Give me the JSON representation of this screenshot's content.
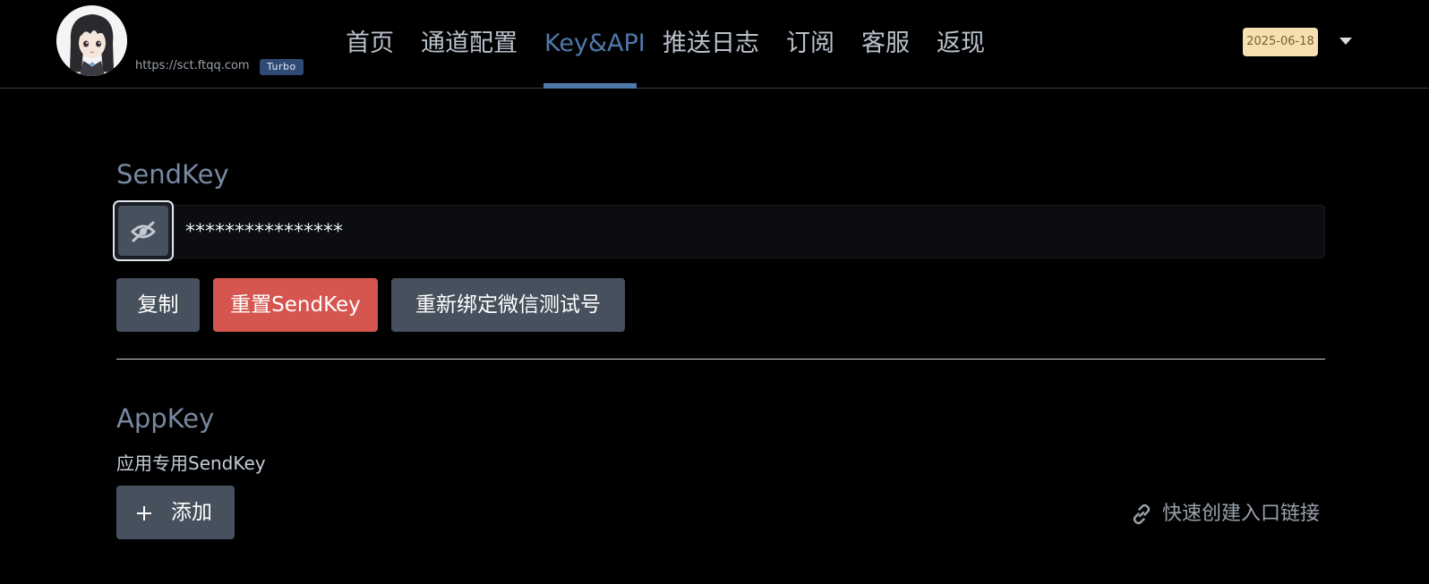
{
  "header": {
    "site_url": "https://sct.ftqq.com",
    "badge": "Turbo",
    "date": "2025-06-18",
    "nav": [
      {
        "label": "首页",
        "active": false
      },
      {
        "label": "通道配置",
        "active": false
      },
      {
        "label": "Key&API",
        "active": true
      },
      {
        "label": "推送日志",
        "active": false
      },
      {
        "label": "订阅",
        "active": false
      },
      {
        "label": "客服",
        "active": false
      },
      {
        "label": "返现",
        "active": false
      }
    ]
  },
  "sendkey": {
    "title": "SendKey",
    "value": "****************",
    "toggle_icon": "eye-slash-icon",
    "buttons": {
      "copy": "复制",
      "reset": "重置SendKey",
      "rebind": "重新绑定微信测试号"
    }
  },
  "appkey": {
    "title": "AppKey",
    "description": "应用专用SendKey",
    "add_label": "添加",
    "quick_link": "快速创建入口链接"
  },
  "colors": {
    "accent": "#4f79ad",
    "danger": "#d5564f",
    "button_gray": "#47505d",
    "date_badge": "#f6dfb1",
    "turbo_badge": "#2e4a75"
  }
}
